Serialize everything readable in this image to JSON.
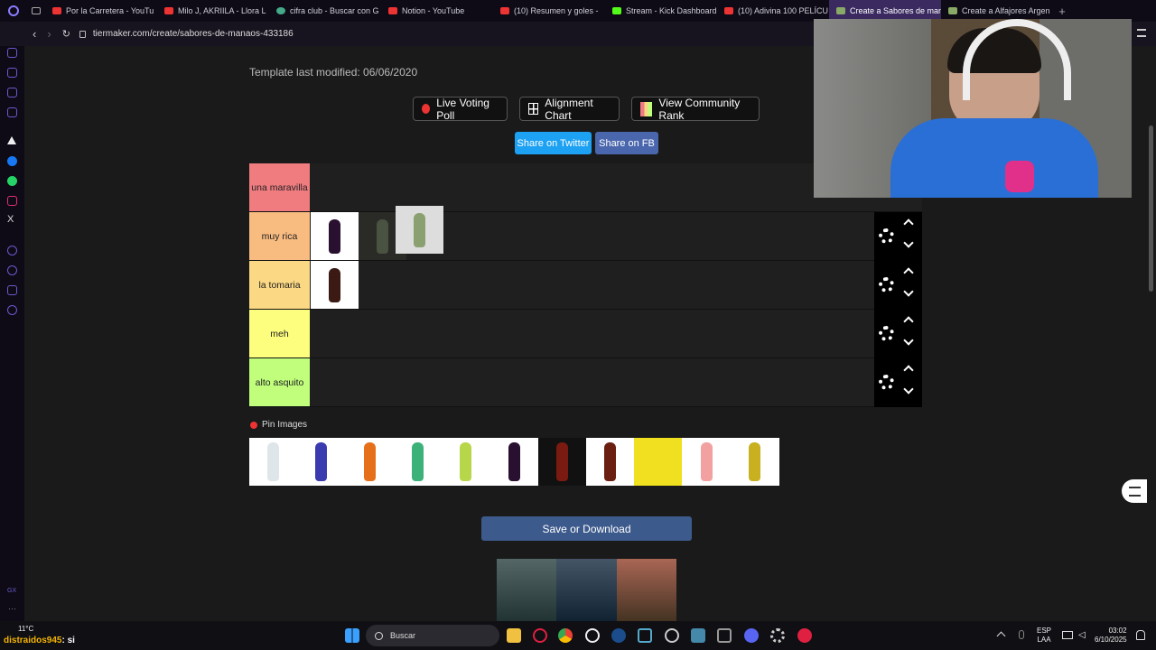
{
  "browser": {
    "tabs": [
      {
        "label": "Por la Carretera - YouTu",
        "color": "#e33"
      },
      {
        "label": "Milo J, AKRIILA - Llora L",
        "color": "#e33"
      },
      {
        "label": "cifra club - Buscar con G",
        "color": "#4a8"
      },
      {
        "label": "Notion - YouTube",
        "color": "#e33"
      },
      {
        "label": "(10) Resumen y goles -",
        "color": "#e33"
      },
      {
        "label": "Stream - Kick Dashboard",
        "color": "#53fc18"
      },
      {
        "label": "(10) Adivina 100 PELÍCU",
        "color": "#e33"
      },
      {
        "label": "Create a Sabores de man",
        "color": "#8a6",
        "active": true
      },
      {
        "label": "Create a Alfajores Argen",
        "color": "#8a6"
      }
    ],
    "url": "tiermaker.com/create/sabores-de-manaos-433186"
  },
  "page": {
    "template_modified": "Template last modified: 06/06/2020",
    "buttons": {
      "live_poll": "Live Voting Poll",
      "alignment": "Alignment Chart",
      "community": "View Community Rank",
      "share_twitter": "Share on Twitter",
      "share_fb": "Share on FB"
    },
    "tiers": [
      {
        "label": "una maravilla",
        "color": "#f07c80"
      },
      {
        "label": "muy rica",
        "color": "#f8bb80"
      },
      {
        "label": "la tomaria",
        "color": "#fbd883"
      },
      {
        "label": "meh",
        "color": "#fefe7e"
      },
      {
        "label": "alto asquito",
        "color": "#c0fe7c"
      }
    ],
    "pin_images_label": "Pin Images",
    "save_button": "Save or Download"
  },
  "pool_colors": [
    "#dfe6ea",
    "#3b3bb0",
    "#e6701a",
    "#3cb27a",
    "#b8d64a",
    "#2a1030",
    "#7a1a10",
    "#6a1f10",
    "#f0e020",
    "#f2a0a0",
    "#c8b020"
  ],
  "overlay": {
    "viewer": "distraidos945",
    "text": ": si",
    "temp": "11°C"
  },
  "taskbar": {
    "search": "Buscar",
    "lang1": "ESP",
    "lang2": "LAA",
    "time": "03:02",
    "date": "6/10/2025"
  }
}
